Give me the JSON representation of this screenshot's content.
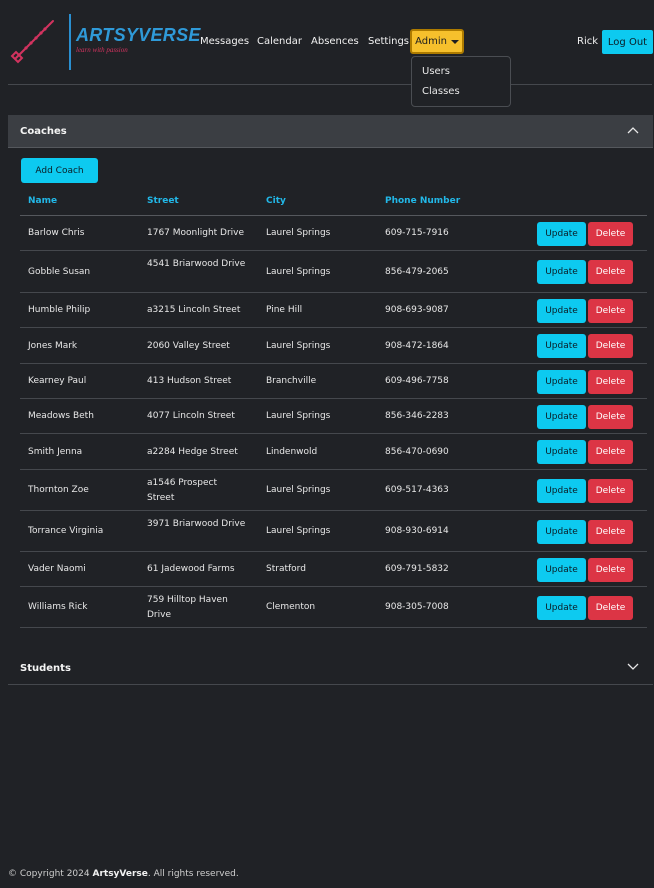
{
  "brand": {
    "name": "ARTSYVERSE",
    "tagline": "learn with passion"
  },
  "nav": {
    "links": [
      "Messages",
      "Calendar",
      "Absences",
      "Settings"
    ],
    "admin_label": "Admin",
    "admin_menu": [
      "Users",
      "Classes"
    ],
    "user_name": "Rick",
    "logout_label": "Log Out"
  },
  "coaches": {
    "title": "Coaches",
    "add_label": "Add Coach",
    "columns": [
      "Name",
      "Street",
      "City",
      "Phone Number"
    ],
    "update_label": "Update",
    "delete_label": "Delete",
    "rows": [
      {
        "name": "Barlow Chris",
        "street": "1767 Moonlight Drive",
        "city": "Laurel Springs",
        "phone": "609-715-7916"
      },
      {
        "name": "Gobble Susan",
        "street": "4541 Briarwood Drive",
        "city": "Laurel Springs",
        "phone": "856-479-2065"
      },
      {
        "name": "Humble Philip",
        "street": "a3215 Lincoln Street",
        "city": "Pine Hill",
        "phone": "908-693-9087"
      },
      {
        "name": "Jones Mark",
        "street": "2060 Valley Street",
        "city": "Laurel Springs",
        "phone": "908-472-1864"
      },
      {
        "name": "Kearney Paul",
        "street": "413 Hudson Street",
        "city": "Branchville",
        "phone": "609-496-7758"
      },
      {
        "name": "Meadows Beth",
        "street": "4077 Lincoln Street",
        "city": "Laurel Springs",
        "phone": "856-346-2283"
      },
      {
        "name": "Smith Jenna",
        "street": "a2284 Hedge Street",
        "city": "Lindenwold",
        "phone": "856-470-0690"
      },
      {
        "name": "Thornton Zoe",
        "street": "a1546 Prospect Street",
        "city": "Laurel Springs",
        "phone": "609-517-4363"
      },
      {
        "name": "Torrance Virginia",
        "street": "3971 Briarwood Drive",
        "city": "Laurel Springs",
        "phone": "908-930-6914"
      },
      {
        "name": "Vader Naomi",
        "street": "61 Jadewood Farms",
        "city": "Stratford",
        "phone": "609-791-5832"
      },
      {
        "name": "Williams Rick",
        "street": "759 Hilltop Haven Drive",
        "city": "Clementon",
        "phone": "908-305-7008"
      }
    ]
  },
  "students": {
    "title": "Students"
  },
  "footer": {
    "prefix": "© Copyright 2024",
    "brand": "ArtsyVerse",
    "suffix": ". All rights reserved."
  },
  "colors": {
    "accent": "#0dcaf0",
    "danger": "#dc3545",
    "warning": "#f6c02c",
    "background": "#202226",
    "brand_blue": "#2f9ad8",
    "brand_pink": "#d2335f"
  }
}
